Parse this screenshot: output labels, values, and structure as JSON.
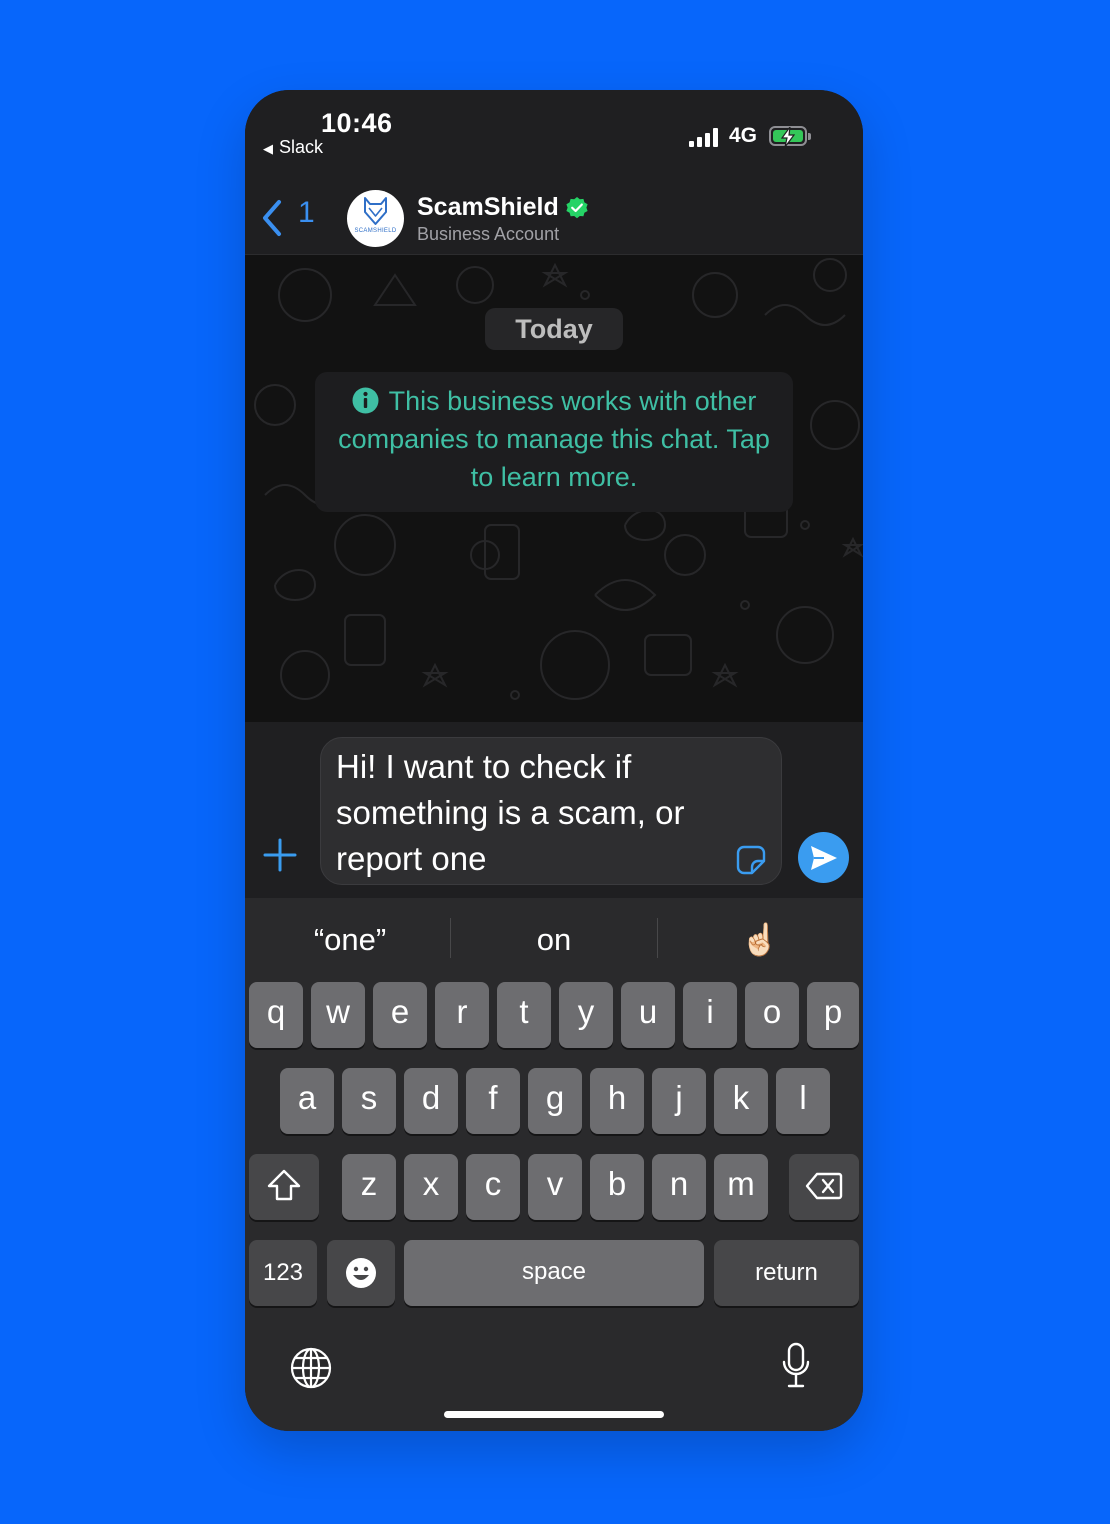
{
  "status_bar": {
    "time": "10:46",
    "back_app": "Slack",
    "network": "4G",
    "battery": "charging"
  },
  "header": {
    "back_count": "1",
    "contact_name": "ScamShield",
    "contact_subtitle": "Business Account",
    "avatar_brand": "SCAMSHIELD",
    "verified": true
  },
  "chat": {
    "date_label": "Today",
    "info_message": "This business works with other companies to manage this chat. Tap to learn more."
  },
  "composer": {
    "input_value": "Hi! I want to check if something is a scam, or report one"
  },
  "keyboard": {
    "suggestions": [
      "“one”",
      "on",
      "☝🏻"
    ],
    "row1": [
      "q",
      "w",
      "e",
      "r",
      "t",
      "y",
      "u",
      "i",
      "o",
      "p"
    ],
    "row2": [
      "a",
      "s",
      "d",
      "f",
      "g",
      "h",
      "j",
      "k",
      "l"
    ],
    "row3": [
      "z",
      "x",
      "c",
      "v",
      "b",
      "n",
      "m"
    ],
    "numbers_label": "123",
    "space_label": "space",
    "return_label": "return"
  },
  "colors": {
    "background": "#0766fb",
    "accent": "#3a9cf0",
    "info_text": "#3fbfa4",
    "verified": "#25d366"
  }
}
